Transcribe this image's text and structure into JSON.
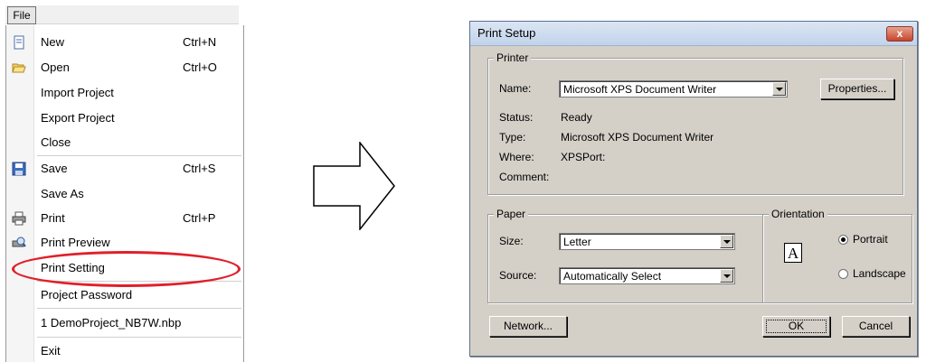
{
  "menu": {
    "title": "File",
    "items": [
      {
        "label": "New",
        "shortcut": "Ctrl+N",
        "icon": "new-doc-icon"
      },
      {
        "label": "Open",
        "shortcut": "Ctrl+O",
        "icon": "folder-open-icon"
      },
      {
        "label": "Import Project"
      },
      {
        "label": "Export Project"
      },
      {
        "label": "Close"
      },
      {
        "label": "Save",
        "shortcut": "Ctrl+S",
        "icon": "floppy-disk-icon"
      },
      {
        "label": "Save As"
      },
      {
        "label": "Print",
        "shortcut": "Ctrl+P",
        "icon": "printer-icon"
      },
      {
        "label": "Print Preview",
        "icon": "print-preview-icon"
      },
      {
        "label": "Print Setting"
      },
      {
        "label": "Project Password"
      },
      {
        "label": "1 DemoProject_NB7W.nbp"
      },
      {
        "label": "Exit"
      }
    ]
  },
  "dialog": {
    "title": "Print Setup",
    "close_glyph": "x",
    "printer": {
      "group_label": "Printer",
      "name_label": "Name:",
      "name_value": "Microsoft XPS Document Writer",
      "properties_button": "Properties...",
      "status_label": "Status:",
      "status_value": "Ready",
      "type_label": "Type:",
      "type_value": "Microsoft XPS Document Writer",
      "where_label": "Where:",
      "where_value": "XPSPort:",
      "comment_label": "Comment:"
    },
    "paper": {
      "group_label": "Paper",
      "size_label": "Size:",
      "size_value": "Letter",
      "source_label": "Source:",
      "source_value": "Automatically Select"
    },
    "orientation": {
      "group_label": "Orientation",
      "icon_letter": "A",
      "portrait_label": "Portrait",
      "landscape_label": "Landscape",
      "selected": "Portrait"
    },
    "buttons": {
      "network": "Network...",
      "ok": "OK",
      "cancel": "Cancel"
    }
  },
  "colors": {
    "highlight_ellipse": "#e0202a",
    "dialog_face": "#d4d0c8"
  }
}
